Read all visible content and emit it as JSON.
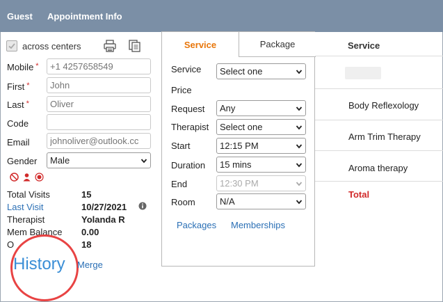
{
  "tabs": {
    "guest": "Guest",
    "appointment_info": "Appointment Info"
  },
  "guest": {
    "across_centers": "across centers",
    "mobile_label": "Mobile",
    "mobile_placeholder": "+1 4257658549",
    "first_label": "First",
    "first_placeholder": "John",
    "last_label": "Last",
    "last_placeholder": "Oliver",
    "code_label": "Code",
    "code_value": "",
    "email_label": "Email",
    "email_placeholder": "johnoliver@outlook.cc",
    "gender_label": "Gender",
    "gender_value": "Male",
    "required_mark": "*",
    "stats": {
      "total_visits_label": "Total Visits",
      "total_visits_value": "15",
      "last_visit_label": "Last Visit",
      "last_visit_value": "10/27/2021",
      "therapist_label": "Therapist",
      "therapist_value": "Yolanda R",
      "mem_balance_label": "Mem Balance",
      "mem_balance_value": "0.00",
      "other_label": "O",
      "other_value": "18"
    },
    "history_link": "History",
    "merge_link": "Merge"
  },
  "popup": {
    "tab_service": "Service",
    "tab_package": "Package",
    "service_label": "Service",
    "service_value": "Select one",
    "price_label": "Price",
    "request_label": "Request",
    "request_value": "Any",
    "therapist_label": "Therapist",
    "therapist_value": "Select one",
    "start_label": "Start",
    "start_value": "12:15 PM",
    "duration_label": "Duration",
    "duration_value": "15 mins",
    "end_label": "End",
    "end_value": "12:30 PM",
    "room_label": "Room",
    "room_value": "N/A",
    "packages_link": "Packages",
    "memberships_link": "Memberships"
  },
  "services_panel": {
    "header": "Service",
    "rows": [
      "Body Reflexology",
      "Arm Trim Therapy",
      "Aroma therapy"
    ],
    "total": "Total"
  },
  "colors": {
    "topbar": "#7b8fa6",
    "accent_orange": "#e8760a",
    "link_blue": "#2a6fb5",
    "required_red": "#d12a2a",
    "highlight_circle": "#e84343"
  }
}
